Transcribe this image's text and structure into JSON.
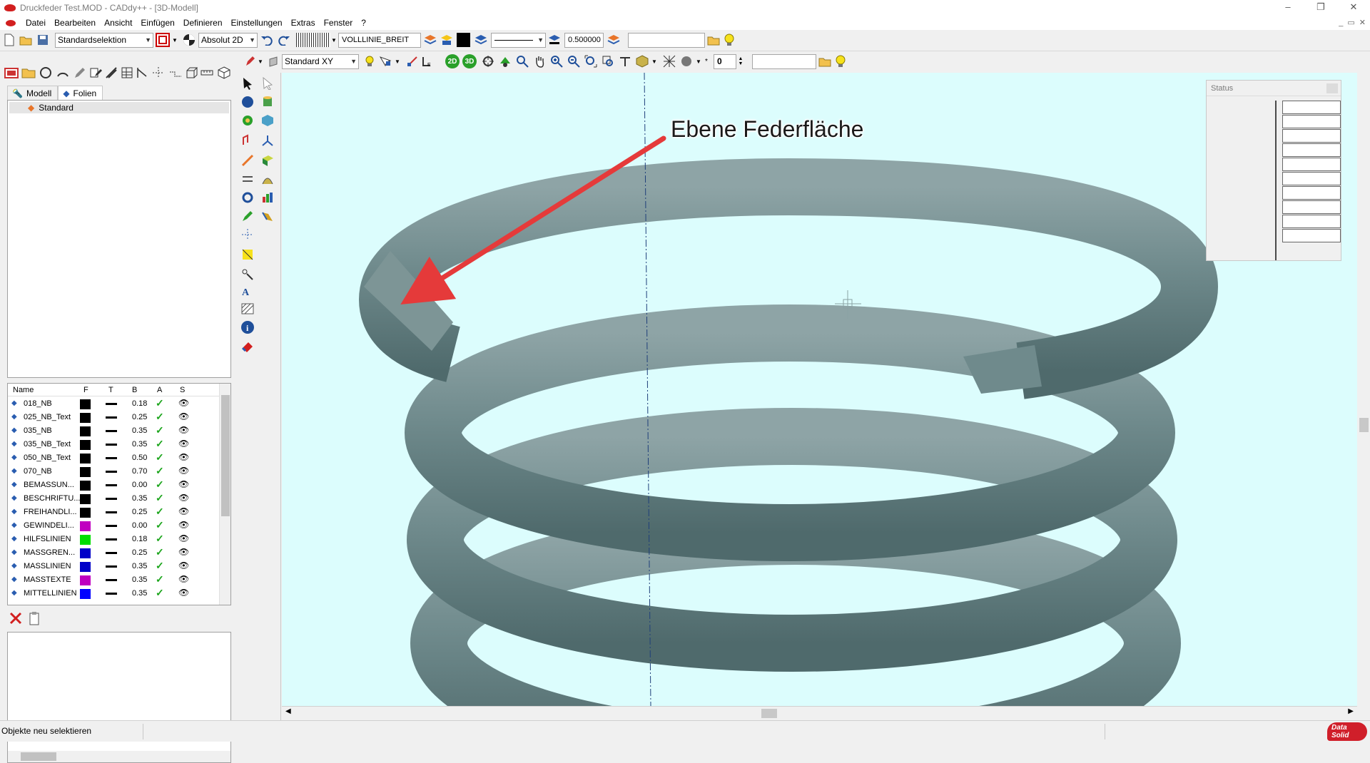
{
  "window": {
    "title": "Druckfeder Test.MOD  -  CADdy++ - [3D-Modell]",
    "min": "–",
    "max": "❐",
    "close": "✕"
  },
  "menu": {
    "items": [
      "Datei",
      "Bearbeiten",
      "Ansicht",
      "Einfügen",
      "Definieren",
      "Einstellungen",
      "Extras",
      "Fenster",
      "?"
    ],
    "mdi": [
      "_",
      "▭",
      "✕"
    ]
  },
  "toolbar1": {
    "selection_mode": "Standardselektion",
    "coord_mode": "Absolut 2D",
    "linetype": "VOLLLINIE_BREIT",
    "linewidth": "0.500000",
    "text_field": ""
  },
  "toolbar2": {
    "view_plane": "Standard XY",
    "btn_2d": "2D",
    "btn_3d": "3D",
    "spin_value": "0",
    "text_field": ""
  },
  "leftpanel": {
    "tabs": [
      {
        "label": "Modell"
      },
      {
        "label": "Folien"
      }
    ],
    "folien_tree": [
      "Standard"
    ],
    "layer_headers": {
      "name": "Name",
      "f": "F",
      "t": "T",
      "b": "B",
      "a": "A",
      "s": "S"
    },
    "layers": [
      {
        "name": "018_NB",
        "color": "#000000",
        "b": "0.18"
      },
      {
        "name": "025_NB_Text",
        "color": "#000000",
        "b": "0.25"
      },
      {
        "name": "035_NB",
        "color": "#000000",
        "b": "0.35"
      },
      {
        "name": "035_NB_Text",
        "color": "#000000",
        "b": "0.35"
      },
      {
        "name": "050_NB_Text",
        "color": "#000000",
        "b": "0.50"
      },
      {
        "name": "070_NB",
        "color": "#000000",
        "b": "0.70"
      },
      {
        "name": "BEMASSUN...",
        "color": "#000000",
        "b": "0.00"
      },
      {
        "name": "BESCHRIFTU...",
        "color": "#000000",
        "b": "0.35"
      },
      {
        "name": "FREIHANDLI...",
        "color": "#000000",
        "b": "0.25"
      },
      {
        "name": "GEWINDELI...",
        "color": "#c000c0",
        "b": "0.00"
      },
      {
        "name": "HILFSLINIEN",
        "color": "#00dd00",
        "b": "0.18"
      },
      {
        "name": "MASSGREN...",
        "color": "#0000c8",
        "b": "0.25"
      },
      {
        "name": "MASSLINIEN",
        "color": "#0000c8",
        "b": "0.35"
      },
      {
        "name": "MASSTEXTE",
        "color": "#c000c0",
        "b": "0.35"
      },
      {
        "name": "MITTELLINIEN",
        "color": "#0000ff",
        "b": "0.35"
      }
    ]
  },
  "canvas": {
    "annotation": "Ebene Federfläche",
    "background": "#dcfdfd",
    "spring_color": "#6f8a8c"
  },
  "status_panel": {
    "title": "Status"
  },
  "statusbar": {
    "message": "Objekte neu selektieren",
    "brand_line1": "Data",
    "brand_line2": "Solid"
  }
}
